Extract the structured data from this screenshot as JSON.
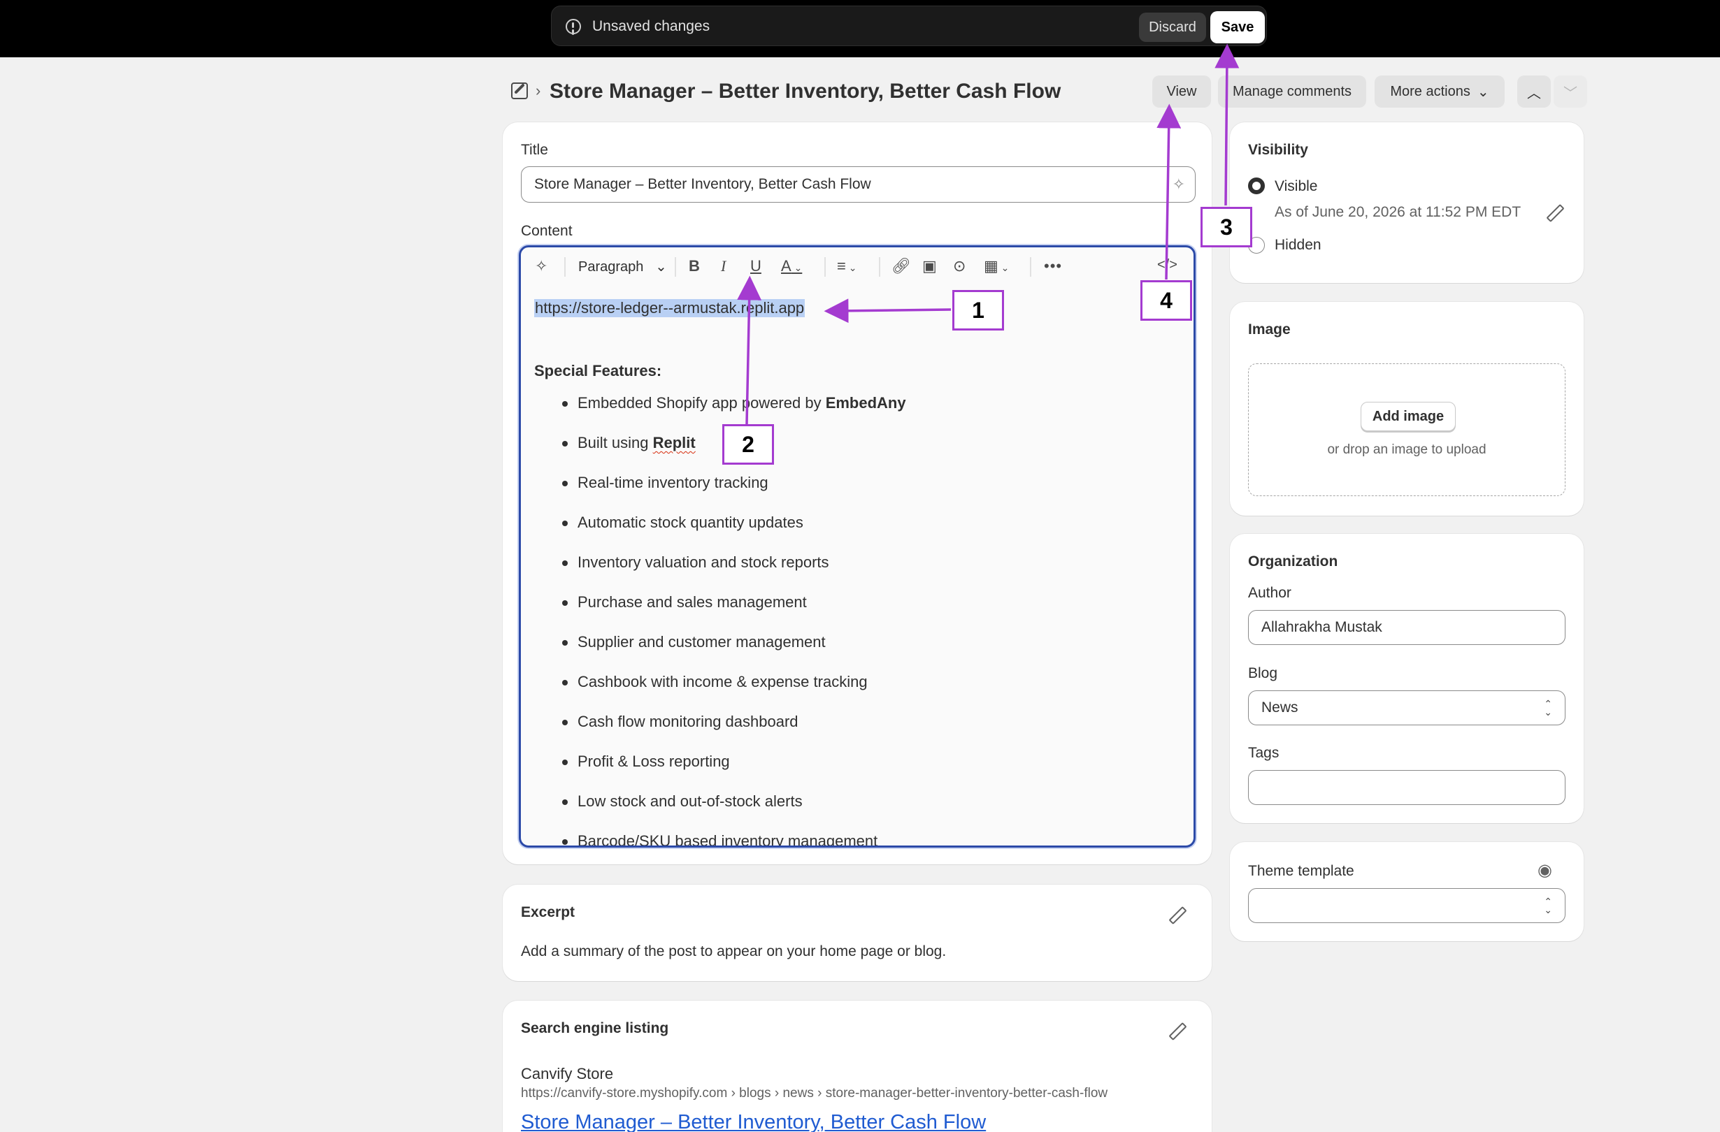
{
  "savebar": {
    "message": "Unsaved changes",
    "discard_label": "Discard",
    "save_label": "Save"
  },
  "header": {
    "title": "Store Manager – Better Inventory, Better Cash Flow",
    "view_label": "View",
    "manage_comments_label": "Manage comments",
    "more_actions_label": "More actions"
  },
  "main": {
    "title_label": "Title",
    "title_value": "Store Manager – Better Inventory, Better Cash Flow",
    "content_label": "Content",
    "toolbar": {
      "paragraph": "Paragraph"
    },
    "content": {
      "url": "https://store-ledger--armustak.replit.app",
      "features_heading": "Special Features:",
      "feature_1_prefix": "Embedded Shopify app powered by ",
      "feature_1_bold": "EmbedAny",
      "feature_2_prefix": "Built using ",
      "feature_2_bold": "Replit",
      "features": [
        "Real-time inventory tracking",
        "Automatic stock quantity updates",
        "Inventory valuation and stock reports",
        "Purchase and sales management",
        "Supplier and customer management",
        "Cashbook with income & expense tracking",
        "Cash flow monitoring dashboard",
        "Profit & Loss reporting",
        "Low stock and out-of-stock alerts",
        "Barcode/SKU based inventory management"
      ]
    }
  },
  "excerpt": {
    "title": "Excerpt",
    "hint": "Add a summary of the post to appear on your home page or blog."
  },
  "seo": {
    "title": "Search engine listing",
    "store_name": "Canvify Store",
    "url": "https://canvify-store.myshopify.com › blogs › news › store-manager-better-inventory-better-cash-flow",
    "link_title": "Store Manager – Better Inventory, Better Cash Flow"
  },
  "visibility": {
    "title": "Visibility",
    "visible_label": "Visible",
    "visible_date": "As of June 20, 2026 at 11:52 PM EDT",
    "hidden_label": "Hidden"
  },
  "image": {
    "title": "Image",
    "add_label": "Add image",
    "drop_hint": "or drop an image to upload"
  },
  "organization": {
    "title": "Organization",
    "author_label": "Author",
    "author_value": "Allahrakha Mustak",
    "blog_label": "Blog",
    "blog_value": "News",
    "tags_label": "Tags",
    "tags_value": ""
  },
  "theme": {
    "title": "Theme template",
    "value": ""
  },
  "annotations": [
    "1",
    "2",
    "3",
    "4"
  ],
  "colors": {
    "annotation": "#a43bd0",
    "editor_focus": "#2c4aa8",
    "selection": "#b9d0f4",
    "link": "#1f5bd1"
  }
}
